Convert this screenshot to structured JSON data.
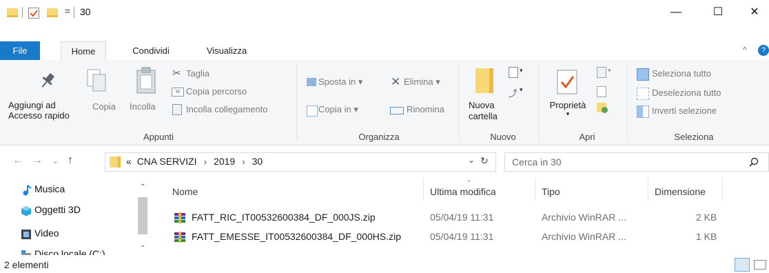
{
  "window": {
    "title": "30",
    "controls": {
      "minimize": "—",
      "maximize": "☐",
      "close": "✕"
    }
  },
  "quick_access": {
    "dropdown": "="
  },
  "tabs": [
    {
      "label": "File"
    },
    {
      "label": "Home"
    },
    {
      "label": "Condividi"
    },
    {
      "label": "Visualizza"
    }
  ],
  "ribbon": {
    "appunti": {
      "group_label": "Appunti",
      "pin_label_1": "Aggiungi ad",
      "pin_label_2": "Accesso rapido",
      "copy": "Copia",
      "paste": "Incolla",
      "cut": "Taglia",
      "copy_path": "Copia percorso",
      "paste_link": "Incolla collegamento"
    },
    "organizza": {
      "group_label": "Organizza",
      "move_to": "Sposta in",
      "copy_to": "Copia in",
      "delete": "Elimina",
      "rename": "Rinomina"
    },
    "nuovo": {
      "group_label": "Nuovo",
      "new_folder_1": "Nuova",
      "new_folder_2": "cartella"
    },
    "apri": {
      "group_label": "Apri",
      "properties": "Proprietà"
    },
    "seleziona": {
      "group_label": "Seleziona",
      "select_all": "Seleziona tutto",
      "select_none": "Deseleziona tutto",
      "invert": "Inverti selezione"
    }
  },
  "address": {
    "overflow": "«",
    "crumbs": [
      "CNA SERVIZI",
      "2019",
      "30"
    ],
    "sep": "›"
  },
  "search": {
    "placeholder": "Cerca in 30"
  },
  "nav_pane": [
    {
      "label": "Musica"
    },
    {
      "label": "Oggetti 3D"
    },
    {
      "label": "Video"
    },
    {
      "label": "Disco locale (C:)"
    }
  ],
  "file_list": {
    "columns": [
      "Nome",
      "Ultima modifica",
      "Tipo",
      "Dimensione"
    ],
    "rows": [
      {
        "name": "FATT_RIC_IT00532600384_DF_000JS.zip",
        "modified": "05/04/19 11:31",
        "type": "Archivio WinRAR ...",
        "size": "2 KB"
      },
      {
        "name": "FATT_EMESSE_IT00532600384_DF_000HS.zip",
        "modified": "05/04/19 11:31",
        "type": "Archivio WinRAR ...",
        "size": "1 KB"
      }
    ]
  },
  "status": {
    "count": "2 elementi"
  },
  "colors": {
    "file_tab": "#1979ca",
    "folder": "#f8d775",
    "accent": "#0078d7"
  }
}
